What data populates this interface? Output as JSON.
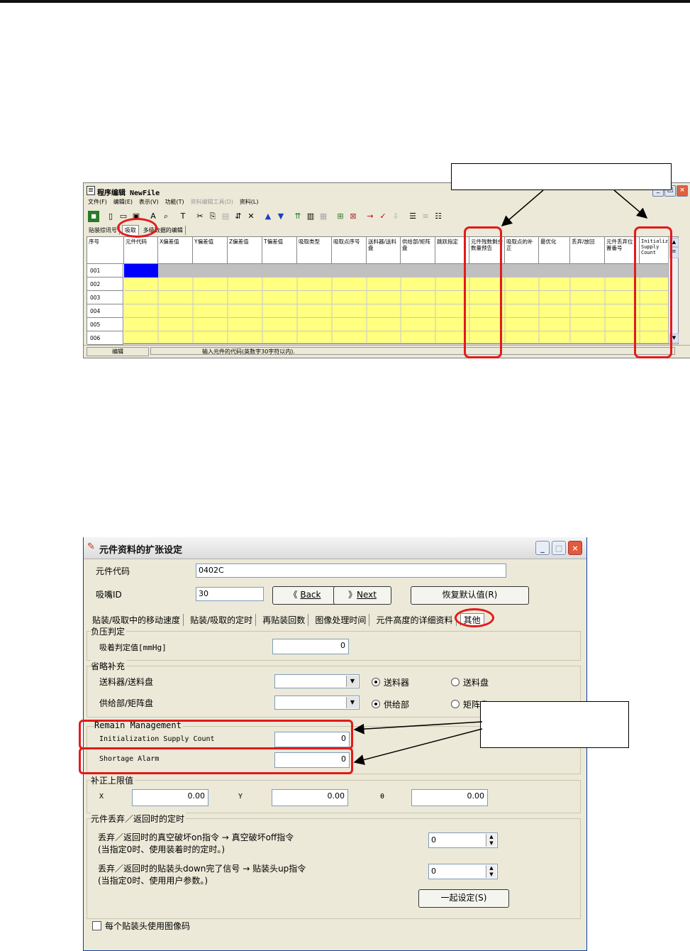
{
  "window1": {
    "title": "程序编辑 NewFile",
    "menu": [
      "文件(F)",
      "编辑(E)",
      "表示(V)",
      "功能(T)",
      "资料编辑工具(D)",
      "资料(L)"
    ],
    "tabs": [
      "贴装综讯号",
      "吸取",
      "多级数据的编辑"
    ],
    "columns": [
      "序号",
      "元件代码",
      "X偏差值",
      "Y偏差值",
      "Z偏差值",
      "T偏差值",
      "吸取类型",
      "吸取点序号",
      "送料器/送料盘",
      "供给部/矩阵盘",
      "跳跃指定",
      "元件残数剩余数量预告",
      "吸取点的补正",
      "最优化",
      "丢弃/放回",
      "元件丢弃位置番号",
      "Initialize Supply Count"
    ],
    "rows": [
      "001",
      "002",
      "003",
      "004",
      "005",
      "006"
    ],
    "status_mode": "编辑",
    "status_msg": "输入元件的代码(英数字30字符以内)."
  },
  "window2": {
    "title": "元件资料的扩张设定",
    "part_code_label": "元件代码",
    "part_code_value": "0402C",
    "nozzle_label": "吸嘴ID",
    "nozzle_value": "30",
    "back_button": "Back",
    "next_button": "Next",
    "restore_button": "恢复默认值(R)",
    "tabs": [
      "贴装/吸取中的移动速度",
      "贴装/吸取的定时",
      "再贴装回数",
      "图像处理时间",
      "元件高度的详细资料",
      "其他"
    ],
    "vacuum_group": "负压判定",
    "vacuum_label": "吸着判定值[mmHg]",
    "vacuum_value": "0",
    "omit_group": "省略补充",
    "feeder_label": "送料器/送料盘",
    "feeder_opt1": "送料器",
    "feeder_opt2": "送料盘",
    "supply_label": "供给部/矩阵盘",
    "supply_opt1": "供给部",
    "supply_opt2": "矩阵盘",
    "remain_group": "Remain Management",
    "init_count_label": "Initialization Supply Count",
    "init_count_value": "0",
    "shortage_label": "Shortage Alarm",
    "shortage_value": "0",
    "limit_group": "补正上限值",
    "x_label": "X",
    "x_value": "0.00",
    "y_label": "Y",
    "y_value": "0.00",
    "theta_label": "θ",
    "theta_value": "0.00",
    "timing_group": "元件丢弃／返回时的定时",
    "timing1_line1": "丢弃／返回时的真空破坏on指令 → 真空破坏off指令",
    "timing1_line2": "(当指定0时、使用装着时的定时。)",
    "timing1_value": "0",
    "timing2_line1": "丢弃／返回时的贴装头down完了信号 → 贴装头up指令",
    "timing2_line2": "(当指定0时、使用用户参数。)",
    "timing2_value": "0",
    "set_all_button": "一起设定(S)",
    "per_head_checkbox": "每个贴装头使用图像码"
  },
  "colors": {
    "grid_yellow": "#ffff80",
    "selected_cell": "#0000ff",
    "annotation_red": "#e31a1a"
  }
}
